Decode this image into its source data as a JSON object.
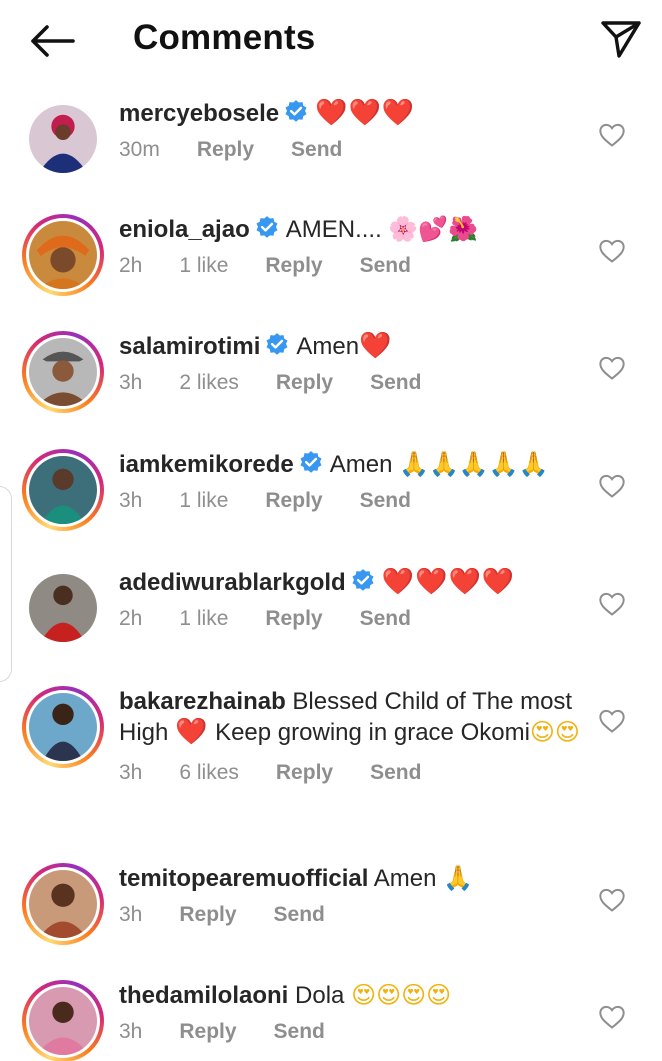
{
  "header": {
    "title": "Comments"
  },
  "comments": [
    {
      "username": "mercyebosele",
      "verified": true,
      "text": "",
      "emoji": "❤️❤️❤️",
      "time": "30m",
      "likes": "",
      "reply": "Reply",
      "send": "Send",
      "ring": false
    },
    {
      "username": "eniola_ajao",
      "verified": true,
      "text": "AMEN....",
      "emoji": "🌸💕🌺",
      "time": "2h",
      "likes": "1 like",
      "reply": "Reply",
      "send": "Send",
      "ring": true
    },
    {
      "username": "salamirotimi",
      "verified": true,
      "text": "Amen",
      "emoji": "❤️",
      "time": "3h",
      "likes": "2 likes",
      "reply": "Reply",
      "send": "Send",
      "ring": true
    },
    {
      "username": "iamkemikorede",
      "verified": true,
      "text": "Amen",
      "emoji": "🙏🙏🙏🙏🙏",
      "time": "3h",
      "likes": "1 like",
      "reply": "Reply",
      "send": "Send",
      "ring": true
    },
    {
      "username": "adediwurablarkgold",
      "verified": true,
      "text": "",
      "emoji": "❤️❤️❤️❤️",
      "time": "2h",
      "likes": "1 like",
      "reply": "Reply",
      "send": "Send",
      "ring": false
    },
    {
      "username": "bakarezhainab",
      "verified": false,
      "text": "Blessed Child of The most High",
      "emoji": "❤️",
      "text2": "Keep growing in grace Okomi",
      "emoji2": "😍😍",
      "time": "3h",
      "likes": "6 likes",
      "reply": "Reply",
      "send": "Send",
      "ring": true
    },
    {
      "username": "temitopearemuofficial",
      "verified": false,
      "text": "Amen",
      "emoji": "🙏",
      "time": "3h",
      "likes": "",
      "reply": "Reply",
      "send": "Send",
      "ring": true
    },
    {
      "username": "thedamilolaoni",
      "verified": false,
      "text": "Dola",
      "emoji": "😍😍😍😍",
      "time": "3h",
      "likes": "",
      "reply": "Reply",
      "send": "Send",
      "ring": true
    }
  ],
  "colors": {
    "heart": "#e0143c",
    "verified": "#3897f0",
    "meta": "#8e8e8e"
  }
}
